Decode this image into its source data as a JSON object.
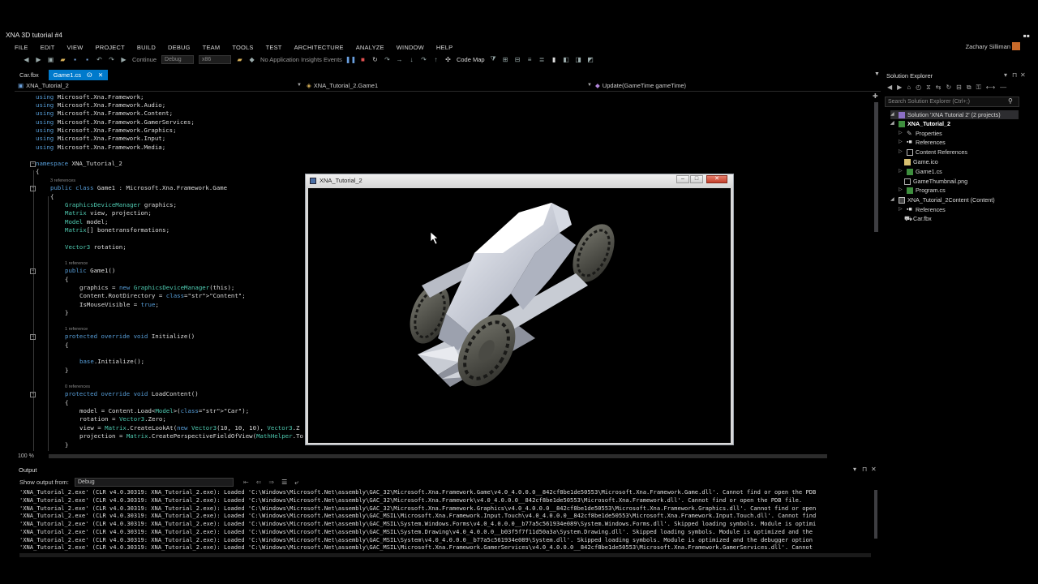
{
  "window": {
    "title": "XNA 3D tutorial #4",
    "user": "Zachary Silliman"
  },
  "menu": [
    "FILE",
    "EDIT",
    "VIEW",
    "PROJECT",
    "BUILD",
    "DEBUG",
    "TEAM",
    "TOOLS",
    "TEST",
    "ARCHITECTURE",
    "ANALYZE",
    "WINDOW",
    "HELP"
  ],
  "toolbar": {
    "continue_label": "Continue",
    "config": "Debug",
    "platform": "x86",
    "insights": "No Application Insights Events",
    "codemap": "Code Map"
  },
  "tabs": [
    {
      "label": "Car.fbx",
      "active": false
    },
    {
      "label": "Game1.cs",
      "active": true,
      "pin": "ⵙ",
      "close": "✕"
    }
  ],
  "navbar": {
    "project": "XNA_Tutorial_2",
    "type": "XNA_Tutorial_2.Game1",
    "member": "Update(GameTime gameTime)"
  },
  "editor": {
    "zoom": "100 %",
    "lines": [
      {
        "t": "using Microsoft.Xna.Framework;"
      },
      {
        "t": "using Microsoft.Xna.Framework.Audio;"
      },
      {
        "t": "using Microsoft.Xna.Framework.Content;"
      },
      {
        "t": "using Microsoft.Xna.Framework.GamerServices;"
      },
      {
        "t": "using Microsoft.Xna.Framework.Graphics;"
      },
      {
        "t": "using Microsoft.Xna.Framework.Input;"
      },
      {
        "t": "using Microsoft.Xna.Framework.Media;"
      },
      {
        "t": "namespace XNA_Tutorial_2"
      },
      {
        "t": "{"
      },
      {
        "t": "3 references"
      },
      {
        "t": "public class Game1 : Microsoft.Xna.Framework.Game"
      },
      {
        "t": "{"
      },
      {
        "t": "GraphicsDeviceManager graphics;"
      },
      {
        "t": "Matrix view, projection;"
      },
      {
        "t": "Model model;"
      },
      {
        "t": "Matrix[] bonetransformations;"
      },
      {
        "t": "Vector3 rotation;"
      },
      {
        "t": "1 reference"
      },
      {
        "t": "public Game1()"
      },
      {
        "t": "{"
      },
      {
        "t": "graphics = new GraphicsDeviceManager(this);"
      },
      {
        "t": "Content.RootDirectory = \"Content\";"
      },
      {
        "t": "IsMouseVisible = true;"
      },
      {
        "t": "}"
      },
      {
        "t": "1 reference"
      },
      {
        "t": "protected override void Initialize()"
      },
      {
        "t": "{"
      },
      {
        "t": "base.Initialize();"
      },
      {
        "t": "}"
      },
      {
        "t": "0 references"
      },
      {
        "t": "protected override void LoadContent()"
      },
      {
        "t": "{"
      },
      {
        "t": "model = Content.Load<Model>(\"Car\");"
      },
      {
        "t": "rotation = Vector3.Zero;"
      },
      {
        "t": "view = Matrix.CreateLookAt(new Vector3(10, 10, 10), Vector3.Z"
      },
      {
        "t": "projection = Matrix.CreatePerspectiveFieldOfView(MathHelper.To"
      },
      {
        "t": "}"
      }
    ]
  },
  "solution_explorer": {
    "title": "Solution Explorer",
    "search_placeholder": "Search Solution Explorer (Ctrl+;)",
    "items": [
      {
        "label": "Solution 'XNA Tutorial 2' (2 projects)",
        "icon": "solution-icon"
      },
      {
        "label": "XNA_Tutorial_2",
        "icon": "csharp-project-icon"
      },
      {
        "label": "Properties",
        "icon": "wrench-icon"
      },
      {
        "label": "References",
        "icon": "references-icon"
      },
      {
        "label": "Content References",
        "icon": "content-references-icon"
      },
      {
        "label": "Game.ico",
        "icon": "ico-file-icon"
      },
      {
        "label": "Game1.cs",
        "icon": "csharp-file-icon"
      },
      {
        "label": "GameThumbnail.png",
        "icon": "image-file-icon"
      },
      {
        "label": "Program.cs",
        "icon": "csharp-file-icon"
      },
      {
        "label": "XNA_Tutorial_2Content (Content)",
        "icon": "content-project-icon"
      },
      {
        "label": "References",
        "icon": "references-icon"
      },
      {
        "label": "Car.fbx",
        "icon": "model-file-icon"
      }
    ]
  },
  "game_window": {
    "title": "XNA_Tutorial_2"
  },
  "output": {
    "title": "Output",
    "show_from_label": "Show output from:",
    "source": "Debug",
    "lines": [
      "'XNA_Tutorial_2.exe' (CLR v4.0.30319: XNA_Tutorial_2.exe): Loaded 'C:\\Windows\\Microsoft.Net\\assembly\\GAC_32\\Microsoft.Xna.Framework.Game\\v4.0_4.0.0.0__842cf8be1de50553\\Microsoft.Xna.Framework.Game.dll'. Cannot find or open the PDB",
      "'XNA_Tutorial_2.exe' (CLR v4.0.30319: XNA_Tutorial_2.exe): Loaded 'C:\\Windows\\Microsoft.Net\\assembly\\GAC_32\\Microsoft.Xna.Framework\\v4.0_4.0.0.0__842cf8be1de50553\\Microsoft.Xna.Framework.dll'. Cannot find or open the PDB file.",
      "'XNA_Tutorial_2.exe' (CLR v4.0.30319: XNA_Tutorial_2.exe): Loaded 'C:\\Windows\\Microsoft.Net\\assembly\\GAC_32\\Microsoft.Xna.Framework.Graphics\\v4.0_4.0.0.0__842cf8be1de50553\\Microsoft.Xna.Framework.Graphics.dll'. Cannot find or open",
      "'XNA_Tutorial_2.exe' (CLR v4.0.30319: XNA_Tutorial_2.exe): Loaded 'C:\\Windows\\Microsoft.Net\\assembly\\GAC_MSIL\\Microsoft.Xna.Framework.Input.Touch\\v4.0_4.0.0.0__842cf8be1de50553\\Microsoft.Xna.Framework.Input.Touch.dll'. Cannot find",
      "'XNA_Tutorial_2.exe' (CLR v4.0.30319: XNA_Tutorial_2.exe): Loaded 'C:\\Windows\\Microsoft.Net\\assembly\\GAC_MSIL\\System.Windows.Forms\\v4.0_4.0.0.0__b77a5c561934e089\\System.Windows.Forms.dll'. Skipped loading symbols. Module is optimi",
      "'XNA_Tutorial_2.exe' (CLR v4.0.30319: XNA_Tutorial_2.exe): Loaded 'C:\\Windows\\Microsoft.Net\\assembly\\GAC_MSIL\\System.Drawing\\v4.0_4.0.0.0__b03f5f7f11d50a3a\\System.Drawing.dll'. Skipped loading symbols. Module is optimized and the",
      "'XNA_Tutorial_2.exe' (CLR v4.0.30319: XNA_Tutorial_2.exe): Loaded 'C:\\Windows\\Microsoft.Net\\assembly\\GAC_MSIL\\System\\v4.0_4.0.0.0__b77a5c561934e089\\System.dll'. Skipped loading symbols. Module is optimized and the debugger option",
      "'XNA_Tutorial_2.exe' (CLR v4.0.30319: XNA_Tutorial_2.exe): Loaded 'C:\\Windows\\Microsoft.Net\\assembly\\GAC_MSIL\\Microsoft.Xna.Framework.GamerServices\\v4.0_4.0.0.0__842cf8be1de50553\\Microsoft.Xna.Framework.GamerServices.dll'. Cannot"
    ]
  },
  "colors": {
    "accent": "#007acc",
    "keyword": "#569cd6",
    "type": "#4ec9b0",
    "string": "#d69d85"
  }
}
